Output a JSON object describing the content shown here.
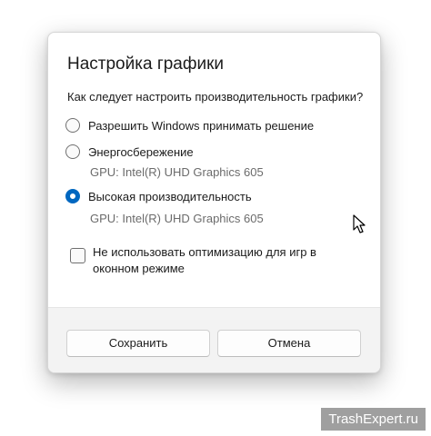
{
  "dialog": {
    "title": "Настройка графики",
    "question": "Как следует настроить производительность графики?",
    "options": [
      {
        "label": "Разрешить Windows принимать решение",
        "gpu": "",
        "selected": false
      },
      {
        "label": "Энергосбережение",
        "gpu": "GPU: Intel(R) UHD Graphics 605",
        "selected": false
      },
      {
        "label": "Высокая производительность",
        "gpu": "GPU: Intel(R) UHD Graphics 605",
        "selected": true
      }
    ],
    "checkbox": {
      "label": "Не использовать оптимизацию для игр в оконном режиме",
      "checked": false
    },
    "buttons": {
      "save_label": "Сохранить",
      "cancel_label": "Отмена"
    }
  },
  "accent_color": "#0067c0",
  "cursor_icon": "mouse-pointer-icon",
  "watermark": "TrashExpert.ru"
}
